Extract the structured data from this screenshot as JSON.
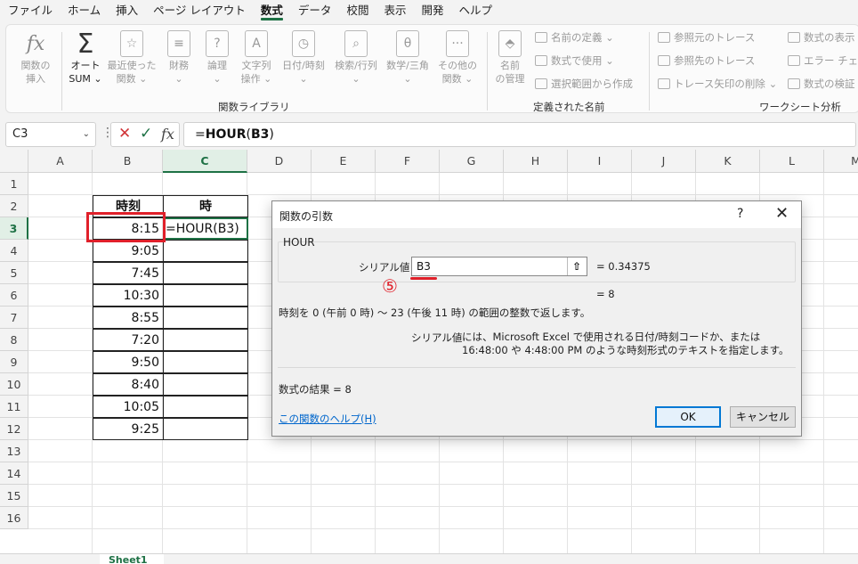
{
  "menu": [
    "ファイル",
    "ホーム",
    "挿入",
    "ページ レイアウト",
    "数式",
    "データ",
    "校閲",
    "表示",
    "開発",
    "ヘルプ"
  ],
  "menu_active_index": 4,
  "ribbon": {
    "insert_fn": [
      "関数の",
      "挿入"
    ],
    "autosum": [
      "オート",
      "SUM ⌄"
    ],
    "recent": [
      "最近使った",
      "関数 ⌄"
    ],
    "financial": [
      "財務",
      "⌄"
    ],
    "logical": [
      "論理",
      "⌄"
    ],
    "text": [
      "文字列",
      "操作 ⌄"
    ],
    "datetime": [
      "日付/時刻",
      "⌄"
    ],
    "lookup": [
      "検索/行列",
      "⌄"
    ],
    "math": [
      "数学/三角",
      "⌄"
    ],
    "other": [
      "その他の",
      "関数 ⌄"
    ],
    "group_library": "関数ライブラリ",
    "name_manager": [
      "名前",
      "の管理"
    ],
    "define_name": "名前の定義 ⌄",
    "use_in_formula": "数式で使用 ⌄",
    "create_from_selection": "選択範囲から作成",
    "group_names": "定義された名前",
    "trace_precedents": "参照元のトレース",
    "trace_dependents": "参照先のトレース",
    "remove_arrows": "トレース矢印の削除 ⌄",
    "show_formulas": "数式の表示",
    "error_checking": "エラー チェック",
    "evaluate_formula": "数式の検証",
    "group_audit": "ワークシート分析"
  },
  "formula_bar": {
    "name_box": "C3",
    "formula_prefix": "=",
    "formula_bold": "HOUR",
    "formula_paren_open": "(",
    "formula_ref": "B3",
    "formula_paren_close": ")"
  },
  "columns": [
    "A",
    "B",
    "C",
    "D",
    "E",
    "F",
    "G",
    "H",
    "I",
    "J",
    "K",
    "L",
    "M"
  ],
  "rows": [
    "1",
    "2",
    "3",
    "4",
    "5",
    "6",
    "7",
    "8",
    "9",
    "10",
    "11",
    "12",
    "13",
    "14",
    "15",
    "16"
  ],
  "table": {
    "header_time": "時刻",
    "header_hour": "時",
    "times": [
      "8:15",
      "9:05",
      "7:45",
      "10:30",
      "8:55",
      "7:20",
      "9:50",
      "8:40",
      "10:05",
      "9:25"
    ],
    "c3_formula": "=HOUR(B3)"
  },
  "sheet_tab": "Sheet1",
  "dialog": {
    "title": "関数の引数",
    "help_icon": "?",
    "close_icon": "✕",
    "function_name": "HOUR",
    "arg_label": "シリアル値",
    "arg_value": "B3",
    "arg_result": "=  0.34375",
    "formula_result_preview": "=  8",
    "annotation_number": "⑤",
    "description": "時刻を 0 (午前 0 時) ～ 23 (午後 11 時) の範囲の整数で返します。",
    "arg_desc_label": "シリアル値",
    "arg_desc_text": "には、Microsoft Excel で使用される日付/時刻コードか、または 16:48:00 や 4:48:00 PM のような時刻形式のテキストを指定します。",
    "result_line": "数式の結果 =  8",
    "help_link": "この関数のヘルプ(H)",
    "ok": "OK",
    "cancel": "キャンセル"
  }
}
